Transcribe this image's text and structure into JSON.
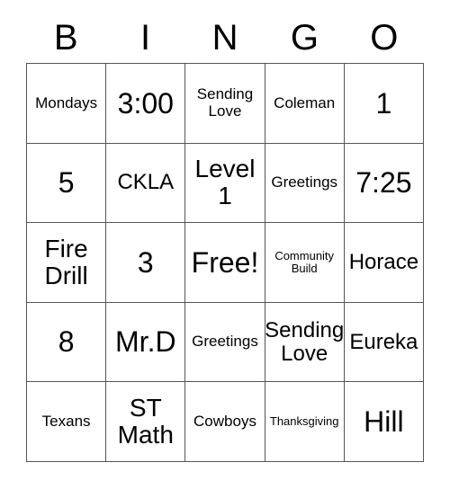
{
  "card": {
    "title_letters": [
      "B",
      "I",
      "N",
      "G",
      "O"
    ],
    "columns": [
      "B",
      "I",
      "N",
      "G",
      "O"
    ],
    "rows": [
      [
        {
          "text": "Mondays",
          "size": "sm"
        },
        {
          "text": "3:00",
          "size": "xl"
        },
        {
          "text": "Sending Love",
          "size": "sm"
        },
        {
          "text": "Coleman",
          "size": "sm"
        },
        {
          "text": "1",
          "size": "xl"
        }
      ],
      [
        {
          "text": "5",
          "size": "xl"
        },
        {
          "text": "CKLA",
          "size": "md"
        },
        {
          "text": "Level 1",
          "size": "lg"
        },
        {
          "text": "Greetings",
          "size": "sm"
        },
        {
          "text": "7:25",
          "size": "xl"
        }
      ],
      [
        {
          "text": "Fire Drill",
          "size": "lg"
        },
        {
          "text": "3",
          "size": "xl"
        },
        {
          "text": "Free!",
          "size": "xl"
        },
        {
          "text": "Community Build",
          "size": "xs"
        },
        {
          "text": "Horace",
          "size": "md"
        }
      ],
      [
        {
          "text": "8",
          "size": "xl"
        },
        {
          "text": "Mr.D",
          "size": "xl"
        },
        {
          "text": "Greetings",
          "size": "sm"
        },
        {
          "text": "Sending Love",
          "size": "md"
        },
        {
          "text": "Eureka",
          "size": "md"
        }
      ],
      [
        {
          "text": "Texans",
          "size": "sm"
        },
        {
          "text": "ST Math",
          "size": "lg"
        },
        {
          "text": "Cowboys",
          "size": "sm"
        },
        {
          "text": "Thanksgiving",
          "size": "xs"
        },
        {
          "text": "Hill",
          "size": "xl"
        }
      ]
    ],
    "free_space": "Free!",
    "colors": {
      "background": "#ffffff",
      "text": "#000000",
      "grid_line": "#555555"
    }
  }
}
